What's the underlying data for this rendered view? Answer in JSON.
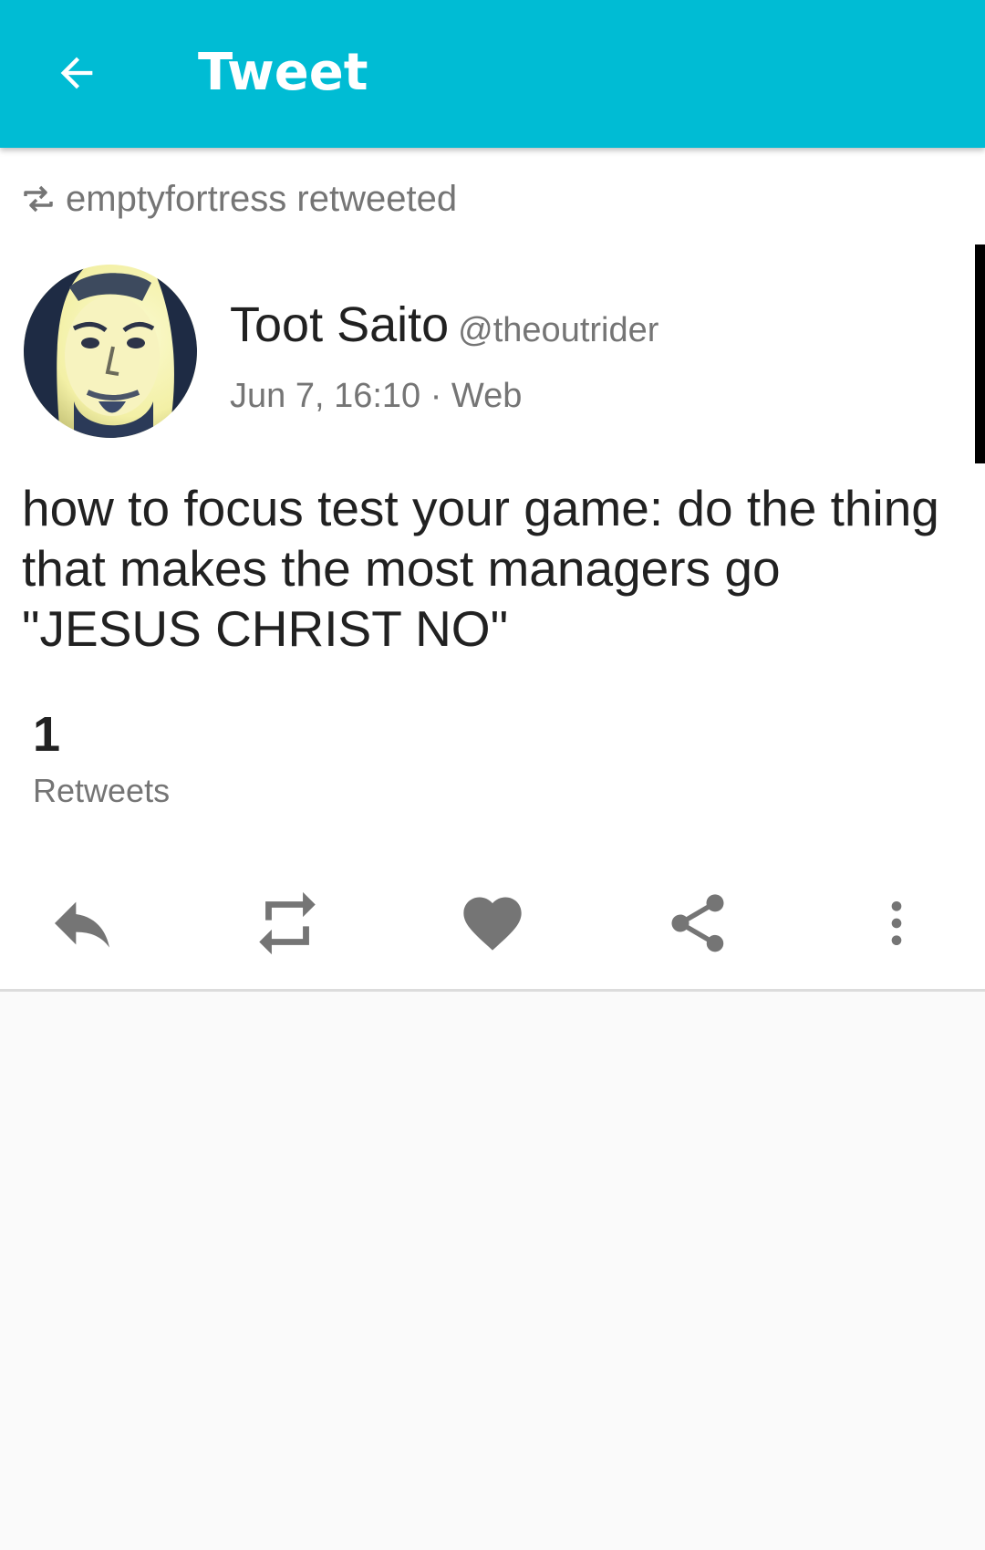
{
  "toolbar": {
    "back_icon": "arrow-back-icon",
    "title": "Tweet",
    "background_color": "#00bcd4"
  },
  "retweet_header": {
    "icon": "retweet-icon",
    "text": "emptyfortress retweeted"
  },
  "tweet": {
    "author_name": "Toot Saito",
    "author_handle": "@theoutrider",
    "meta": "Jun 7, 16:10 · Web",
    "text": "how to focus test your game: do the thing that makes the most managers go \"JESUS CHRIST NO\""
  },
  "stats": {
    "retweets_count": "1",
    "retweets_label": "Retweets"
  },
  "actions": [
    {
      "name": "reply",
      "icon": "reply-icon"
    },
    {
      "name": "retweet",
      "icon": "retweet-icon"
    },
    {
      "name": "like",
      "icon": "heart-icon"
    },
    {
      "name": "share",
      "icon": "share-icon"
    },
    {
      "name": "more",
      "icon": "more-vert-icon"
    }
  ],
  "colors": {
    "accent": "#00bcd4",
    "primary_text": "#212121",
    "secondary_text": "#757575",
    "action_icon": "#757575"
  }
}
